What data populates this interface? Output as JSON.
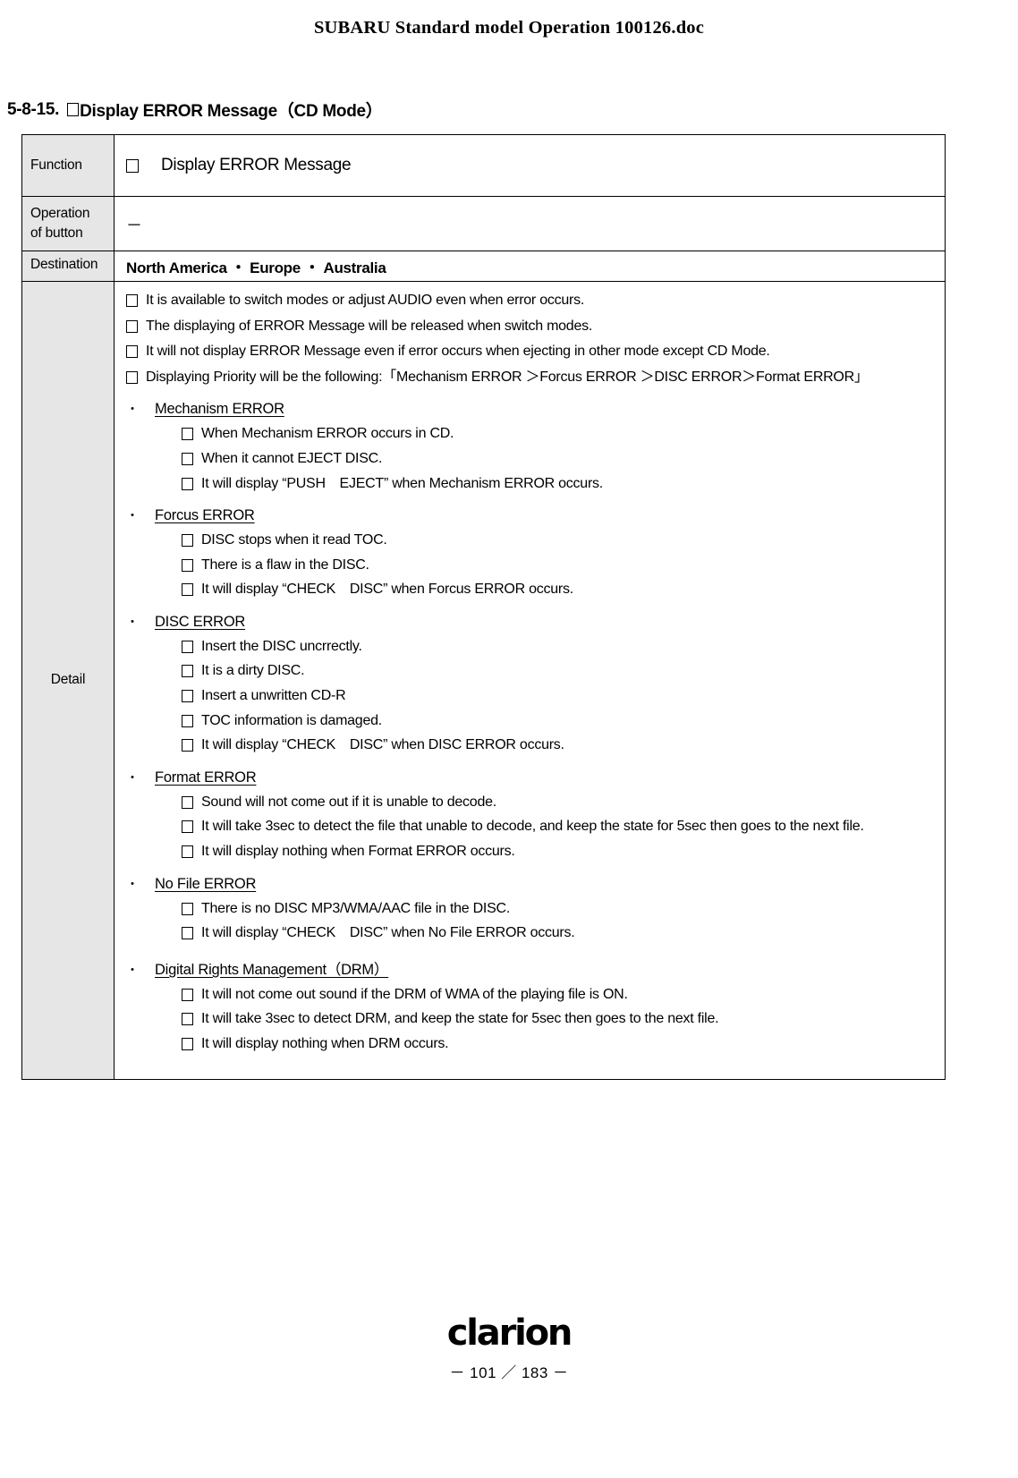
{
  "header": {
    "title": "SUBARU Standard model Operation 100126.doc"
  },
  "section": {
    "number": "5-8-15.",
    "title": "Display ERROR Message（CD Mode）"
  },
  "table": {
    "labels": {
      "function": "Function",
      "operation_of_button": "Operation\nof button",
      "destination": "Destination",
      "detail": "Detail"
    },
    "function_value": "Display ERROR Message",
    "operation_value": "－",
    "destination_value": "North America ・ Europe ・ Australia"
  },
  "detail": {
    "top_notes": [
      "It is available to switch modes or adjust AUDIO even when error occurs.",
      "The displaying of ERROR Message will be released when switch modes.",
      "It will not display ERROR Message even if error occurs when ejecting in other mode except CD Mode.",
      "Displaying Priority will be the following:「Mechanism ERROR ＞Forcus ERROR ＞DISC ERROR＞Format ERROR」"
    ],
    "groups": [
      {
        "bullet": "・",
        "title": "Mechanism ERROR",
        "items": [
          "When Mechanism ERROR occurs in CD.",
          "When it cannot EJECT DISC.",
          "It will display “PUSH　EJECT” when Mechanism ERROR occurs."
        ]
      },
      {
        "bullet": "・",
        "title": "Forcus ERROR",
        "items": [
          "DISC stops when it read TOC.",
          "There is a flaw in the DISC.",
          "It will display “CHECK　DISC” when Forcus ERROR occurs."
        ]
      },
      {
        "bullet": "・",
        "title": "DISC ERROR",
        "items": [
          "Insert the DISC uncrrectly.",
          "It is a dirty DISC.",
          "Insert a unwritten CD-R",
          "TOC information is damaged.",
          "It will display “CHECK　DISC” when DISC ERROR occurs."
        ]
      },
      {
        "bullet": "・",
        "title": "Format ERROR",
        "items": [
          "Sound will not come out if it is unable to decode.",
          "It will take 3sec to detect the file that unable to decode, and keep the state for 5sec then goes to the next file.",
          "It will display nothing when Format ERROR occurs."
        ]
      },
      {
        "bullet": "・",
        "title": "No File ERROR",
        "items": [
          "There is no DISC MP3/WMA/AAC file in the DISC.",
          " It will display “CHECK　DISC” when No File ERROR occurs."
        ]
      },
      {
        "bullet": "・",
        "title": "Digital Rights Management（DRM）",
        "items": [
          "It will not come out sound if the DRM of WMA of the playing file is ON.",
          "It will take 3sec to detect DRM, and keep the state for 5sec then goes to the next file.",
          "It will display nothing when DRM occurs."
        ]
      }
    ]
  },
  "footer": {
    "brand": "clarion",
    "page": "－ 101 ／ 183 －"
  },
  "colors": {
    "label_cell_bg": "#e6e6e6",
    "border": "#000000",
    "text": "#000000"
  }
}
